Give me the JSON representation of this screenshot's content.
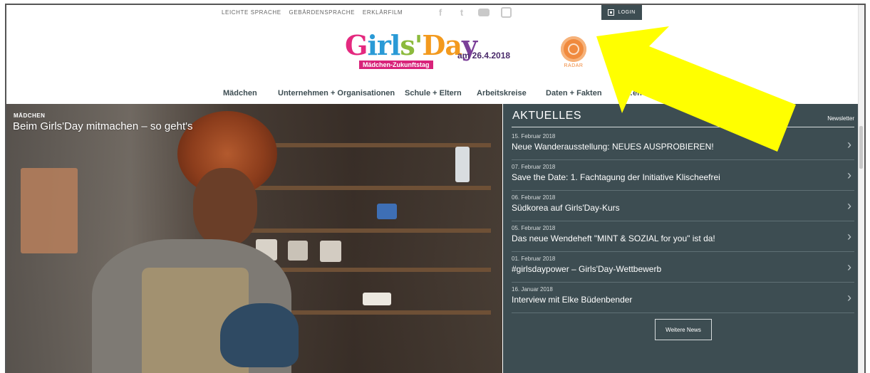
{
  "topbar": {
    "links": [
      "LEICHTE SPRACHE",
      "GEBÄRDENSPRACHE",
      "ERKLÄRFILM"
    ],
    "social": [
      {
        "icon": "facebook-icon",
        "glyph": "f"
      },
      {
        "icon": "twitter-icon",
        "glyph": "t"
      },
      {
        "icon": "youtube-icon",
        "glyph": ""
      },
      {
        "icon": "instagram-icon",
        "glyph": ""
      }
    ],
    "login_label": "LOGIN"
  },
  "logo": {
    "word_parts": [
      "G",
      "irl",
      "s'",
      "Da",
      "y"
    ],
    "subtitle": "Mädchen-Zukunftstag",
    "date": "am 26.4.2018"
  },
  "radar": {
    "label": "RADAR"
  },
  "nav": {
    "items": [
      "Mädchen",
      "Unternehmen + Organisationen",
      "Schule + Eltern",
      "Arbeitskreise",
      "Daten + Fakten",
      "…en"
    ]
  },
  "hero": {
    "category": "MÄDCHEN",
    "title": "Beim Girls'Day mitmachen – so geht's"
  },
  "news": {
    "heading": "AKTUELLES",
    "newsletter_label": "Newsletter",
    "items": [
      {
        "date": "15. Februar 2018",
        "title": "Neue Wanderausstellung: NEUES AUSPROBIEREN!"
      },
      {
        "date": "07. Februar 2018",
        "title": "Save the Date: 1. Fachtagung der Initiative Klischeefrei"
      },
      {
        "date": "06. Februar 2018",
        "title": "Südkorea auf Girls'Day-Kurs"
      },
      {
        "date": "05. Februar 2018",
        "title": "Das neue Wendeheft \"MINT & SOZIAL for you\" ist da!"
      },
      {
        "date": "01. Februar 2018",
        "title": "#girlsdaypower – Girls'Day-Wettbewerb"
      },
      {
        "date": "16. Januar 2018",
        "title": "Interview mit Elke Büdenbender"
      }
    ],
    "more_label": "Weitere News"
  },
  "colors": {
    "panel": "#3d4d52",
    "accent_pink": "#d8237a",
    "radar_orange": "#f08a3e",
    "annotation_arrow": "#ffff00"
  }
}
